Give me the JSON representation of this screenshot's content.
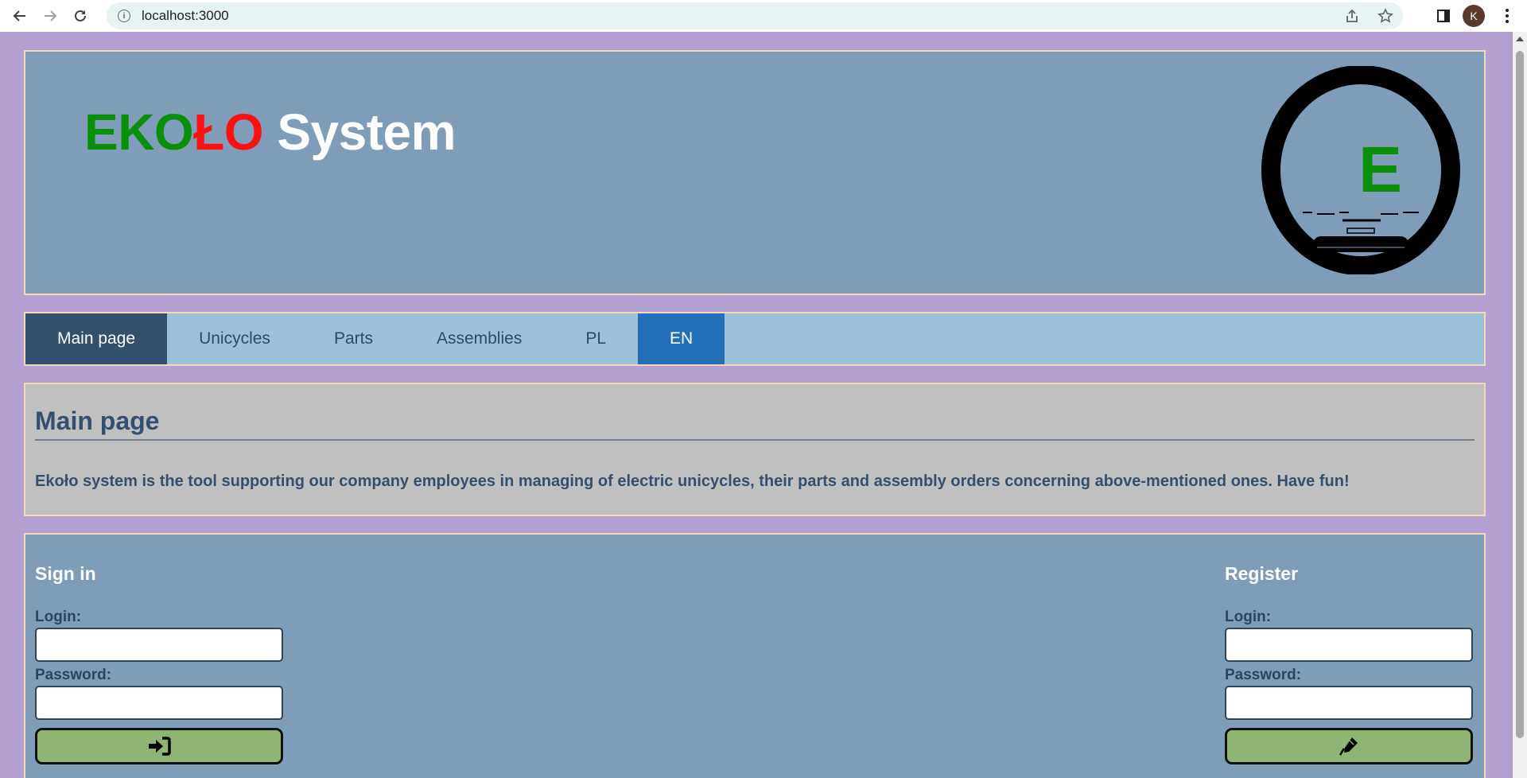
{
  "browser": {
    "url": "localhost:3000",
    "profile_initial": "K"
  },
  "header": {
    "brand_part1": "EKO",
    "brand_part2": "ŁO",
    "brand_part3": " System",
    "logo_letter": "E",
    "colors": {
      "green": "#0a8f0a",
      "red": "#ff1010"
    }
  },
  "nav": {
    "items": [
      {
        "label": "Main page",
        "active": true
      },
      {
        "label": "Unicycles"
      },
      {
        "label": "Parts"
      },
      {
        "label": "Assemblies"
      },
      {
        "label": "PL"
      },
      {
        "label": "EN",
        "selected_language": true
      }
    ]
  },
  "main": {
    "title": "Main page",
    "description": "Ekoło system is the tool supporting our company employees in managing of electric unicycles, their parts and assembly orders concerning above-mentioned ones. Have fun!"
  },
  "sign_in": {
    "title": "Sign in",
    "login_label": "Login:",
    "password_label": "Password:",
    "button_icon": "sign-in-icon"
  },
  "register": {
    "title": "Register",
    "login_label": "Login:",
    "password_label": "Password:",
    "button_icon": "pen-icon"
  }
}
